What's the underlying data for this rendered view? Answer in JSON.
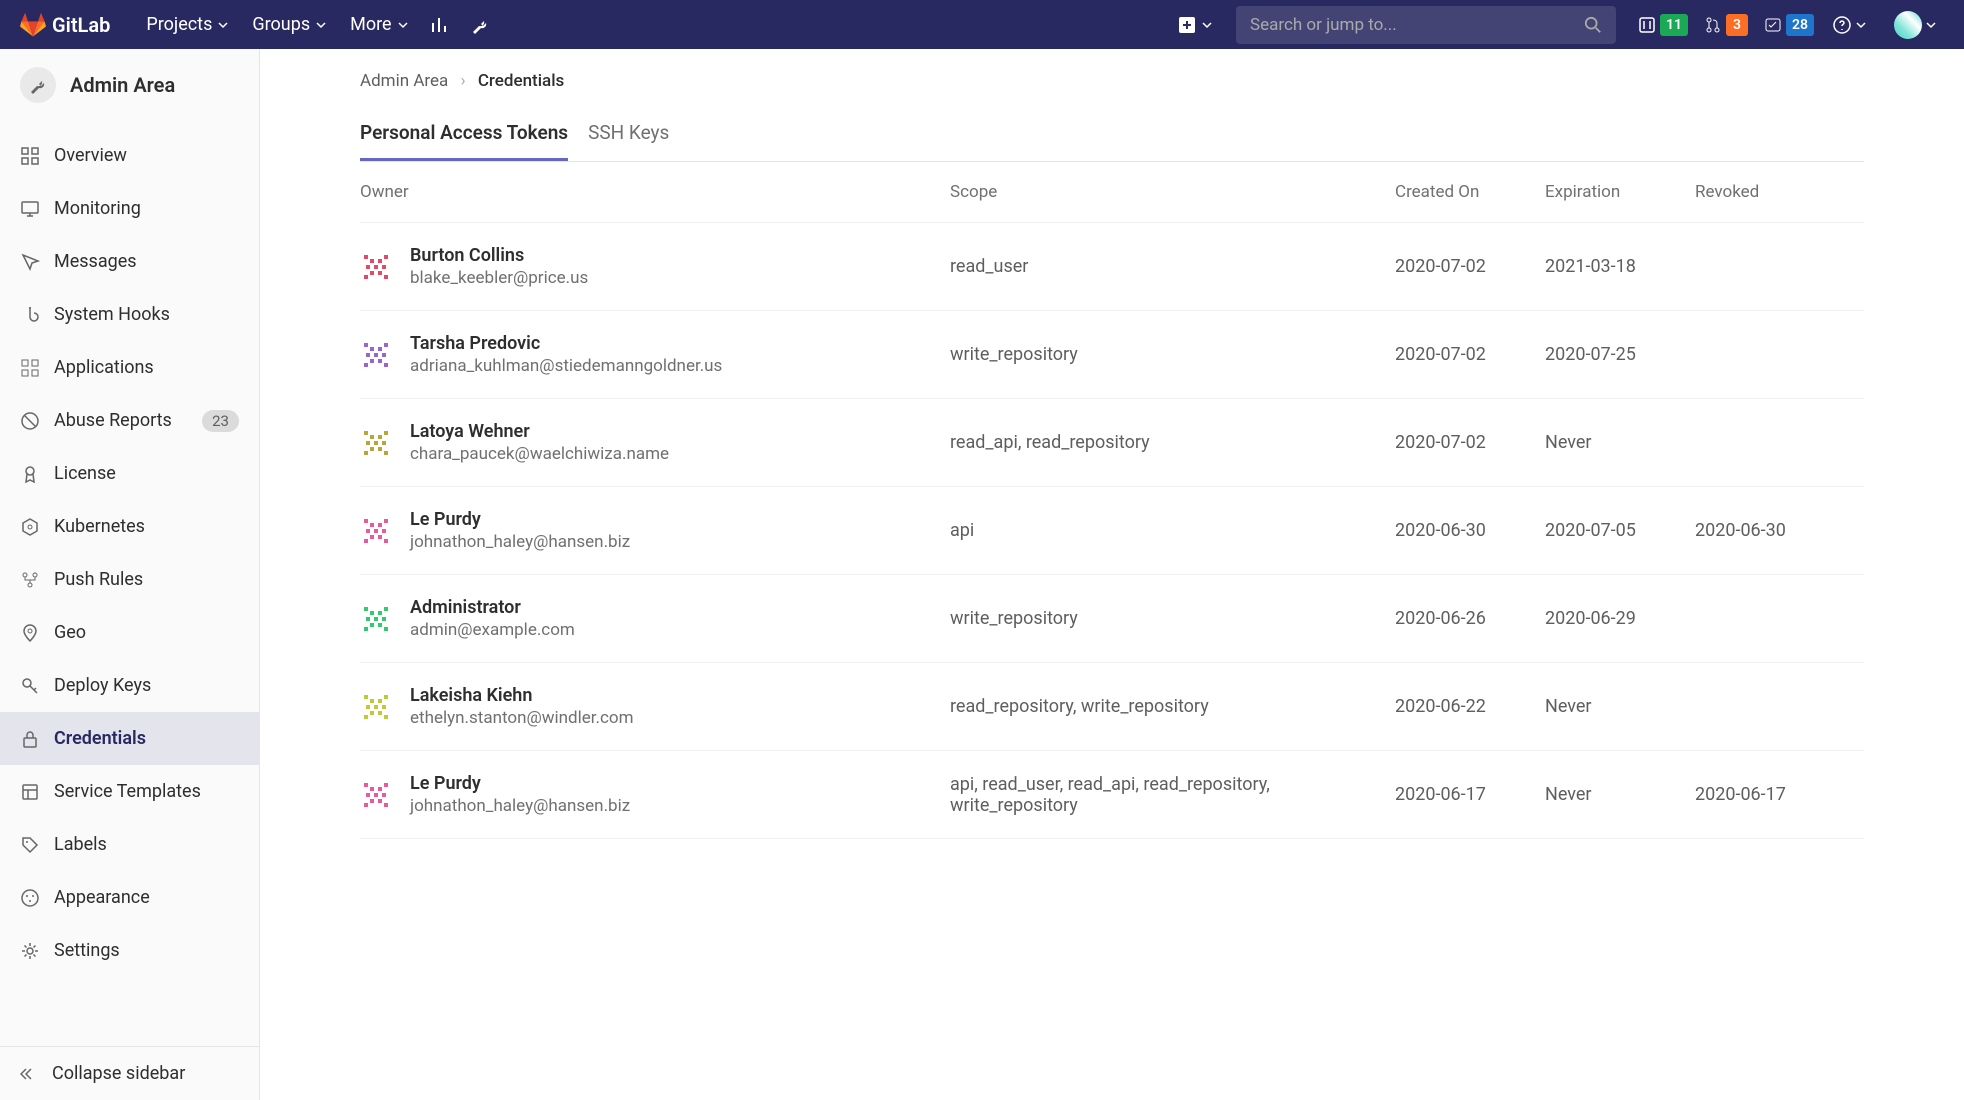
{
  "brand": "GitLab",
  "nav": {
    "projects": "Projects",
    "groups": "Groups",
    "more": "More"
  },
  "search": {
    "placeholder": "Search or jump to..."
  },
  "counters": {
    "issues": "11",
    "mrs": "3",
    "todos": "28"
  },
  "sidebar": {
    "title": "Admin Area",
    "items": [
      {
        "label": "Overview",
        "icon": "overview"
      },
      {
        "label": "Monitoring",
        "icon": "monitor"
      },
      {
        "label": "Messages",
        "icon": "messages"
      },
      {
        "label": "System Hooks",
        "icon": "hook"
      },
      {
        "label": "Applications",
        "icon": "apps"
      },
      {
        "label": "Abuse Reports",
        "icon": "abuse",
        "badge": "23"
      },
      {
        "label": "License",
        "icon": "license"
      },
      {
        "label": "Kubernetes",
        "icon": "kube"
      },
      {
        "label": "Push Rules",
        "icon": "push"
      },
      {
        "label": "Geo",
        "icon": "geo"
      },
      {
        "label": "Deploy Keys",
        "icon": "key"
      },
      {
        "label": "Credentials",
        "icon": "lock",
        "active": true
      },
      {
        "label": "Service Templates",
        "icon": "template"
      },
      {
        "label": "Labels",
        "icon": "label"
      },
      {
        "label": "Appearance",
        "icon": "appearance"
      },
      {
        "label": "Settings",
        "icon": "settings"
      }
    ],
    "collapse": "Collapse sidebar"
  },
  "breadcrumb": {
    "root": "Admin Area",
    "current": "Credentials"
  },
  "tabs": {
    "pat": "Personal Access Tokens",
    "ssh": "SSH Keys"
  },
  "columns": {
    "owner": "Owner",
    "scope": "Scope",
    "created": "Created On",
    "expiration": "Expiration",
    "revoked": "Revoked"
  },
  "rows": [
    {
      "name": "Burton Collins",
      "email": "blake_keebler@price.us",
      "scope": "read_user",
      "created": "2020-07-02",
      "expiration": "2021-03-18",
      "revoked": "",
      "color": "#e24a68"
    },
    {
      "name": "Tarsha Predovic",
      "email": "adriana_kuhlman@stiedemanngoldner.us",
      "scope": "write_repository",
      "created": "2020-07-02",
      "expiration": "2020-07-25",
      "revoked": "",
      "color": "#9966cc"
    },
    {
      "name": "Latoya Wehner",
      "email": "chara_paucek@waelchiwiza.name",
      "scope": "read_api, read_repository",
      "created": "2020-07-02",
      "expiration": "Never",
      "revoked": "",
      "color": "#b8a639"
    },
    {
      "name": "Le Purdy",
      "email": "johnathon_haley@hansen.biz",
      "scope": "api",
      "created": "2020-06-30",
      "expiration": "2020-07-05",
      "revoked": "2020-06-30",
      "color": "#e85a9c"
    },
    {
      "name": "Administrator",
      "email": "admin@example.com",
      "scope": "write_repository",
      "created": "2020-06-26",
      "expiration": "2020-06-29",
      "revoked": "",
      "color": "#2ecc71"
    },
    {
      "name": "Lakeisha Kiehn",
      "email": "ethelyn.stanton@windler.com",
      "scope": "read_repository, write_repository",
      "created": "2020-06-22",
      "expiration": "Never",
      "revoked": "",
      "color": "#c0ca33"
    },
    {
      "name": "Le Purdy",
      "email": "johnathon_haley@hansen.biz",
      "scope": "api, read_user, read_api, read_repository, write_repository",
      "created": "2020-06-17",
      "expiration": "Never",
      "revoked": "2020-06-17",
      "color": "#e85a9c"
    }
  ]
}
